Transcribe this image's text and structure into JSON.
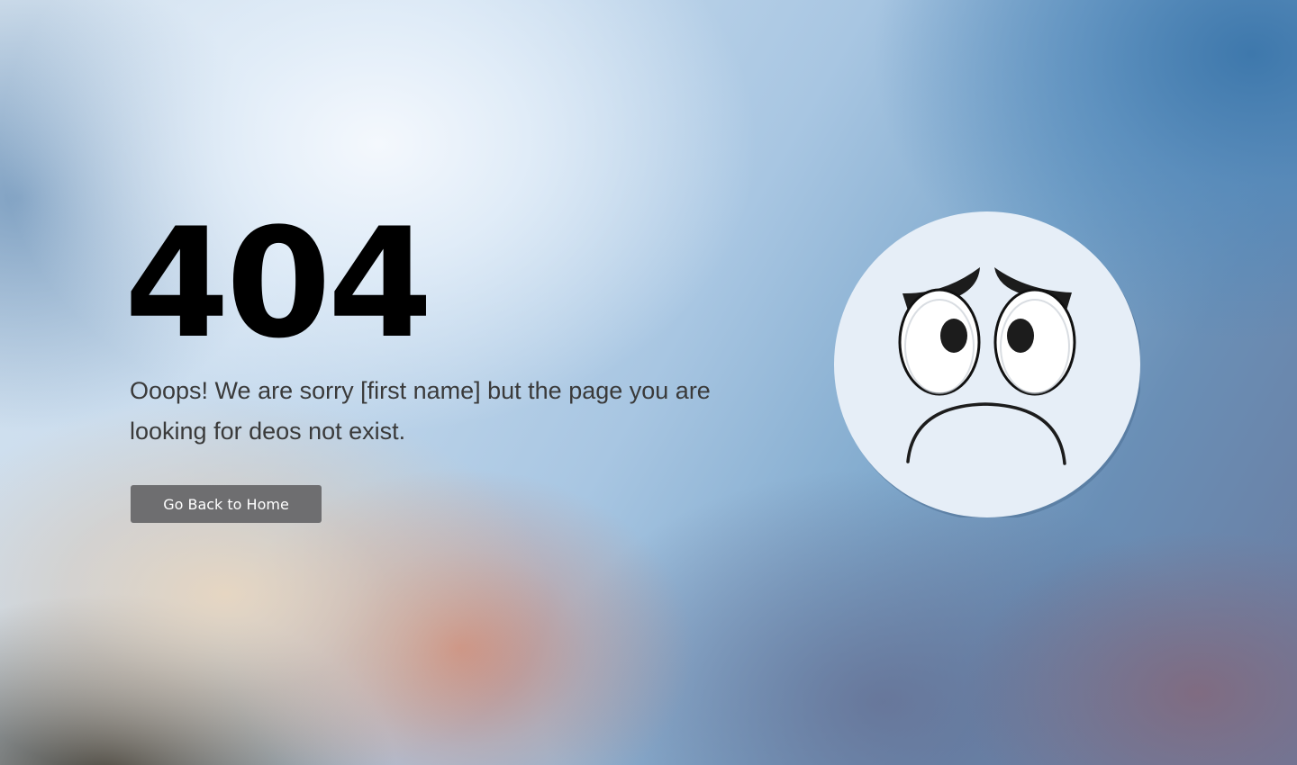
{
  "error": {
    "code": "404",
    "message": "Ooops! We are sorry [first name] but the page you are looking for deos not exist."
  },
  "actions": {
    "home_label": "Go Back to Home"
  },
  "illustration": {
    "icon": "sad-face-icon",
    "face_color": "#e6eef7",
    "stroke_color": "#1a1a1a"
  },
  "colors": {
    "button_bg": "#6e6e70",
    "button_text": "#ffffff",
    "heading": "#000000",
    "text": "#3a3a3a"
  }
}
